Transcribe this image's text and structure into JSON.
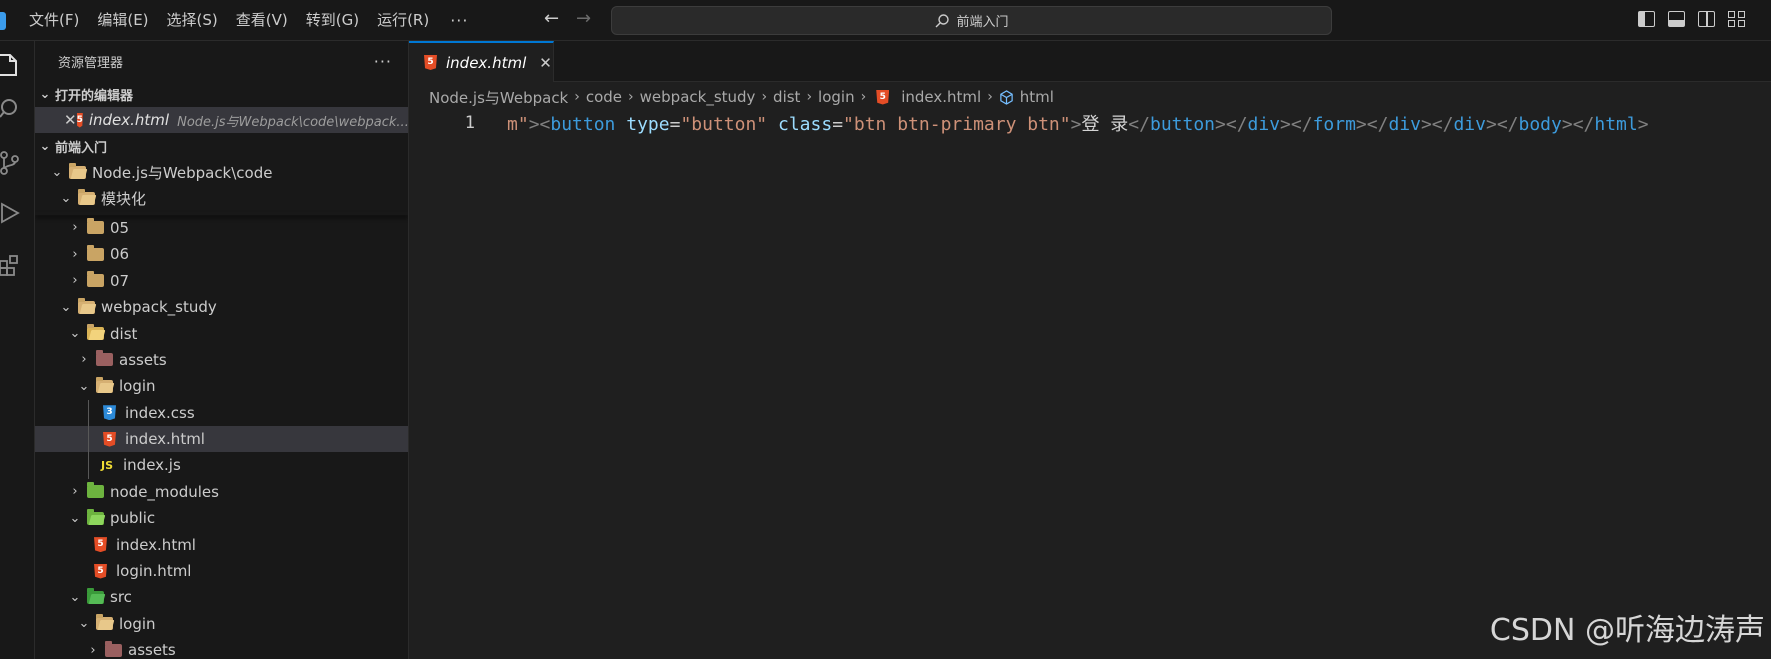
{
  "menu": [
    "文件(F)",
    "编辑(E)",
    "选择(S)",
    "查看(V)",
    "转到(G)",
    "运行(R)"
  ],
  "menu_more": "···",
  "search": {
    "text": "前端入门"
  },
  "sidebar": {
    "title": "资源管理器",
    "more": "···",
    "open_editors_section": "打开的编辑器",
    "open_editor": {
      "name": "index.html",
      "path": "Node.js与Webpack\\code\\webpack..."
    },
    "workspace_section": "前端入门",
    "tree": [
      {
        "label": "Node.js与Webpack\\code"
      },
      {
        "label": "模块化"
      },
      {
        "label": "05"
      },
      {
        "label": "06"
      },
      {
        "label": "07"
      },
      {
        "label": "webpack_study"
      },
      {
        "label": "dist"
      },
      {
        "label": "assets"
      },
      {
        "label": "login"
      },
      {
        "label": "index.css"
      },
      {
        "label": "index.html"
      },
      {
        "label": "index.js"
      },
      {
        "label": "node_modules"
      },
      {
        "label": "public"
      },
      {
        "label": "index.html"
      },
      {
        "label": "login.html"
      },
      {
        "label": "src"
      },
      {
        "label": "login"
      },
      {
        "label": "assets"
      }
    ]
  },
  "tab": {
    "label": "index.html",
    "icon_text": "5"
  },
  "breadcrumb": [
    "Node.js与Webpack",
    "code",
    "webpack_study",
    "dist",
    "login",
    "index.html",
    "html"
  ],
  "editor": {
    "line_number": "1",
    "tokens": [
      "m\"",
      "><",
      "button",
      " ",
      "type",
      "=",
      "\"button\"",
      " ",
      "class",
      "=",
      "\"btn btn-primary btn\"",
      ">",
      "登 录",
      "</",
      "button",
      "></",
      "div",
      "></",
      "form",
      "></",
      "div",
      "></",
      "div",
      "></",
      "body",
      "></",
      "html",
      ">"
    ]
  },
  "watermark": "CSDN @听海边涛声",
  "colors": {
    "accent": "#0078d4",
    "html_icon": "#e44d26",
    "css_icon": "#2c8ad8",
    "js_icon": "#f1dd35"
  }
}
